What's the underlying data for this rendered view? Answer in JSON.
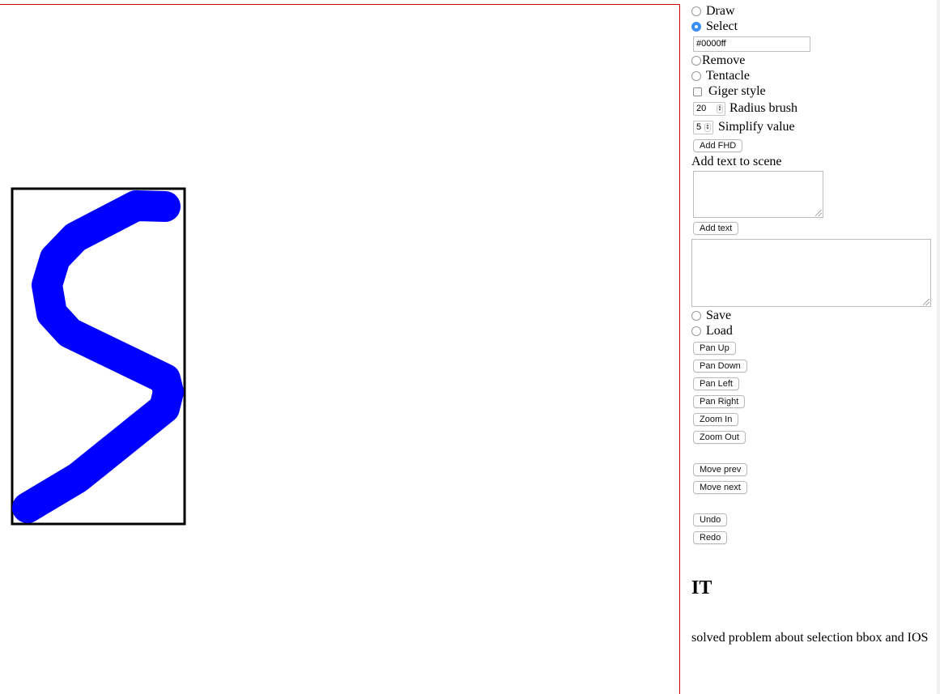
{
  "mode_options": {
    "draw": "Draw",
    "select": "Select",
    "selected": "Select"
  },
  "color_input": {
    "value": "#0000ff"
  },
  "tool_options": {
    "remove": "Remove",
    "tentacle": "Tentacle"
  },
  "giger_style": {
    "label": "Giger style",
    "checked": false
  },
  "radius_brush": {
    "value": "20",
    "label": "Radius brush"
  },
  "simplify": {
    "value": "5",
    "label": "Simplify value"
  },
  "buttons": {
    "add_fhd": "Add FHD",
    "add_text": "Add text",
    "pan_up": "Pan Up",
    "pan_down": "Pan Down",
    "pan_left": "Pan Left",
    "pan_right": "Pan Right",
    "zoom_in": "Zoom In",
    "zoom_out": "Zoom Out",
    "move_prev": "Move prev",
    "move_next": "Move next",
    "undo": "Undo",
    "redo": "Redo"
  },
  "add_text_section": {
    "label": "Add text to scene",
    "value": ""
  },
  "output_area": {
    "value": ""
  },
  "file_options": {
    "save": "Save",
    "load": "Load"
  },
  "notes": {
    "heading": "IT",
    "message": "solved problem about selection bbox and IOS"
  },
  "colors": {
    "stroke": "#0000ff",
    "canvas_border": "#d00000",
    "selection_bbox": "#000000",
    "radio_checked": "#3b8ff3"
  }
}
